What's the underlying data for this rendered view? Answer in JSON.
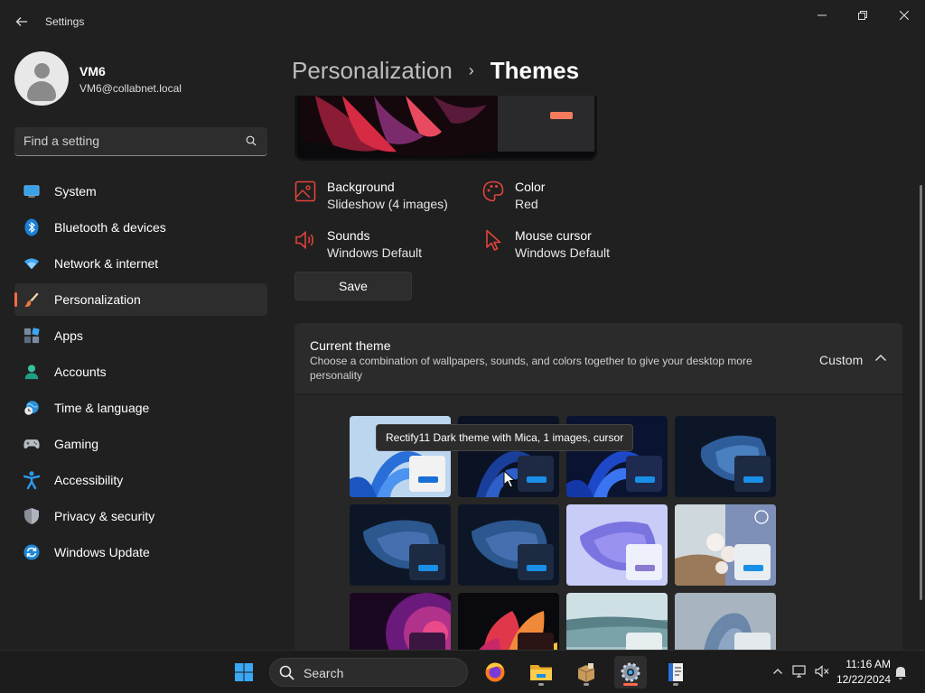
{
  "window": {
    "title": "Settings",
    "back_icon": "back-arrow-icon",
    "minimize_icon": "minimize-icon",
    "maximize_icon": "restore-icon",
    "close_icon": "close-icon"
  },
  "profile": {
    "name": "VM6",
    "email": "VM6@collabnet.local"
  },
  "search": {
    "placeholder": "Find a setting",
    "icon": "search-icon"
  },
  "sidebar": {
    "items": [
      {
        "label": "System",
        "icon": "system-icon"
      },
      {
        "label": "Bluetooth & devices",
        "icon": "bluetooth-icon"
      },
      {
        "label": "Network & internet",
        "icon": "wifi-icon"
      },
      {
        "label": "Personalization",
        "icon": "brush-icon",
        "selected": true
      },
      {
        "label": "Apps",
        "icon": "apps-icon"
      },
      {
        "label": "Accounts",
        "icon": "accounts-icon"
      },
      {
        "label": "Time & language",
        "icon": "globe-clock-icon"
      },
      {
        "label": "Gaming",
        "icon": "gamepad-icon"
      },
      {
        "label": "Accessibility",
        "icon": "accessibility-icon"
      },
      {
        "label": "Privacy & security",
        "icon": "shield-icon"
      },
      {
        "label": "Windows Update",
        "icon": "update-icon"
      }
    ]
  },
  "header": {
    "parent": "Personalization",
    "separator": "›",
    "current": "Themes"
  },
  "theme_props": {
    "background": {
      "title": "Background",
      "value": "Slideshow (4 images)",
      "icon": "image-icon"
    },
    "color": {
      "title": "Color",
      "value": "Red",
      "icon": "palette-icon"
    },
    "sounds": {
      "title": "Sounds",
      "value": "Windows Default",
      "icon": "speaker-icon"
    },
    "cursor": {
      "title": "Mouse cursor",
      "value": "Windows Default",
      "icon": "cursor-icon"
    }
  },
  "save_label": "Save",
  "current_theme": {
    "title": "Current theme",
    "description": "Choose a combination of wallpapers, sounds, and colors together to give your desktop more personality",
    "value": "Custom",
    "chevron_icon": "chevron-up-icon"
  },
  "tooltip": "Rectify11 Dark theme with Mica, 1 images, cursor",
  "theme_tiles": [
    {
      "name": "windows-light-bloom",
      "style": "light-bloom"
    },
    {
      "name": "rectify11-dark-mica",
      "style": "dark-bloom"
    },
    {
      "name": "windows-dark-bloom",
      "style": "dark-bloom2"
    },
    {
      "name": "glow-dark",
      "style": "glow-dark"
    },
    {
      "name": "glow-dark-2",
      "style": "glow-dark"
    },
    {
      "name": "glow-dark-3",
      "style": "glow-dark"
    },
    {
      "name": "glow-light",
      "style": "glow-light"
    },
    {
      "name": "flowers",
      "style": "flowers"
    },
    {
      "name": "captured-motion",
      "style": "purple"
    },
    {
      "name": "flow",
      "style": "flow"
    },
    {
      "name": "sunrise",
      "style": "lake"
    },
    {
      "name": "sculpture",
      "style": "sculpture"
    }
  ],
  "taskbar": {
    "search_label": "Search",
    "apps": [
      "start-icon",
      "firefox-icon",
      "file-explorer-icon",
      "package-icon",
      "settings-icon",
      "book-icon"
    ],
    "tray": {
      "time": "11:16 AM",
      "date": "12/22/2024"
    }
  },
  "colors": {
    "accent": "#ff6a4a",
    "window_bg": "#202020",
    "card_bg": "#2b2b2b",
    "icon_red": "#e0443b"
  }
}
